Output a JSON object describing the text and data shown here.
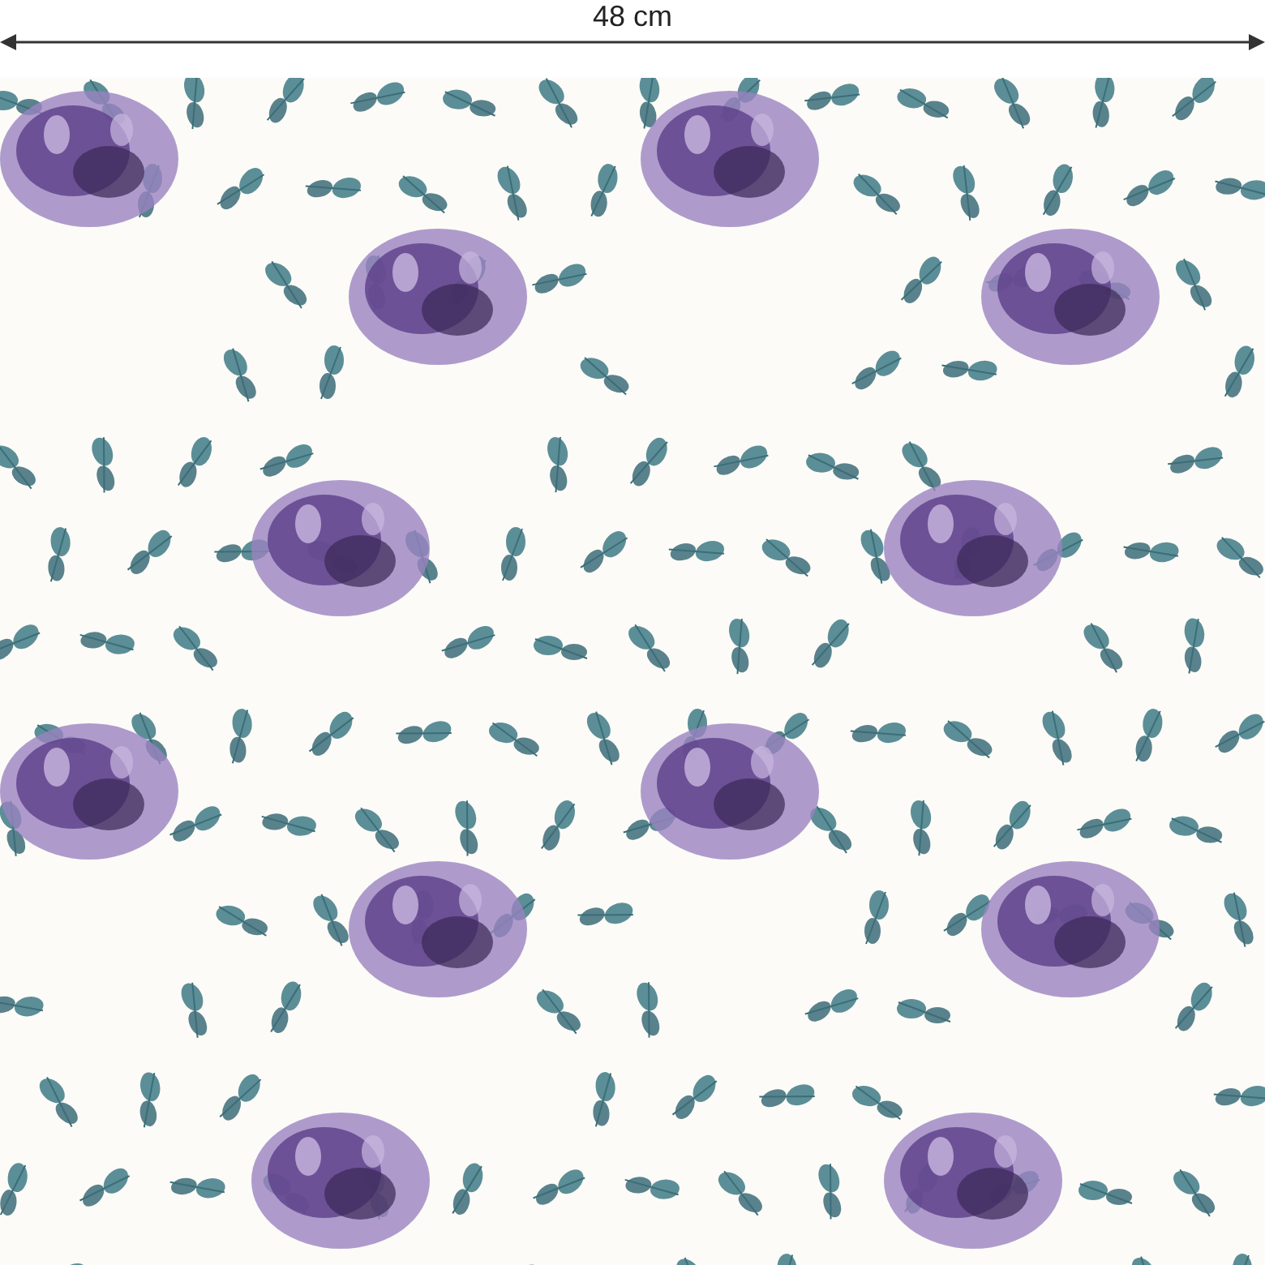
{
  "dimension": {
    "label": "48 cm"
  }
}
